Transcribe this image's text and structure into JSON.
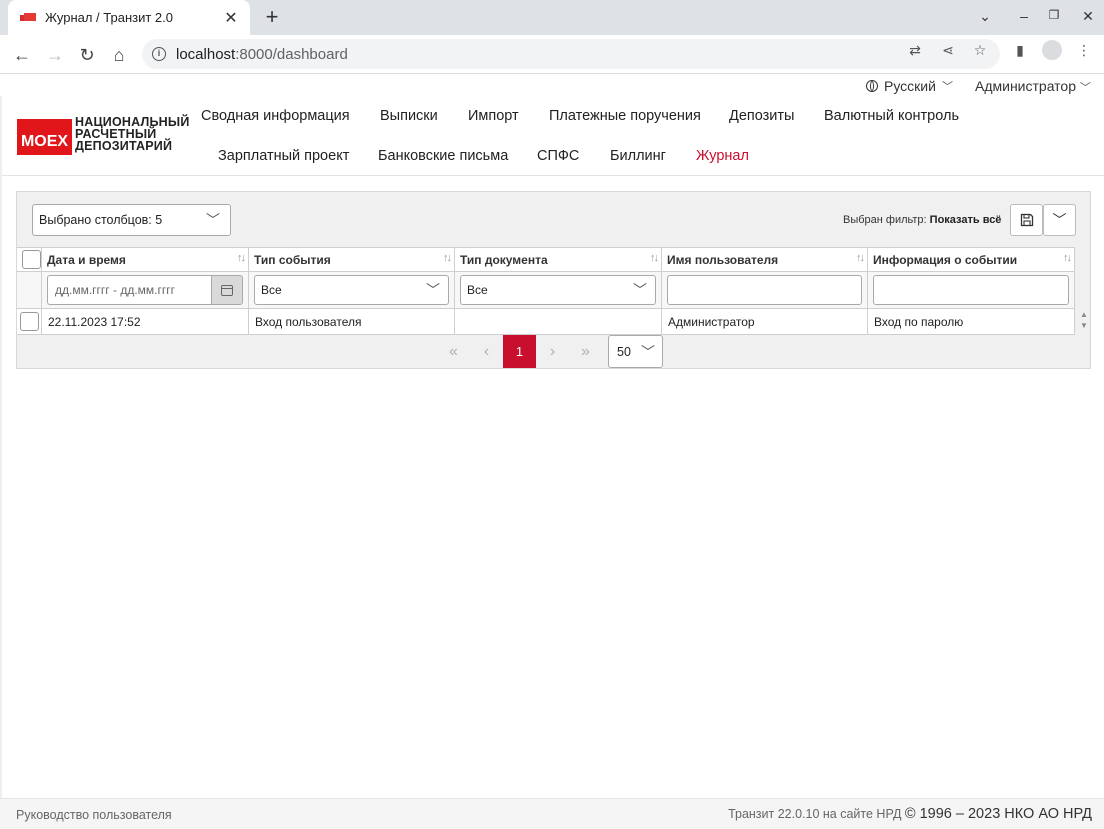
{
  "browser": {
    "tab_title": "Журнал / Транзит 2.0",
    "url_host": "localhost",
    "url_path": ":8000/dashboard"
  },
  "app": {
    "language": "Русский",
    "user": "Администратор",
    "logo_text": "MOEX",
    "logo_lines": [
      "НАЦИОНАЛЬНЫЙ",
      "РАСЧЕТНЫЙ",
      "ДЕПОЗИТАРИЙ"
    ],
    "brand_color": "#e1161b",
    "accent_color": "#c8102e",
    "nav_row1": [
      "Сводная информация",
      "Выписки",
      "Импорт",
      "Платежные поручения",
      "Депозиты",
      "Валютный контроль"
    ],
    "nav_row2": [
      "Зарплатный проект",
      "Банковские письма",
      "СПФС",
      "Биллинг",
      "Журнал"
    ],
    "active_nav": "Журнал"
  },
  "toolbar": {
    "columns_selected": "Выбрано столбцов: 5",
    "filter_label": "Выбран фильтр:",
    "filter_value": "Показать всё"
  },
  "table": {
    "columns": [
      "Дата и время",
      "Тип события",
      "Тип документа",
      "Имя пользователя",
      "Информация о событии"
    ],
    "filters": {
      "date_placeholder": "дд.мм.гггг - дд.мм.гггг",
      "event_type": "Все",
      "doc_type": "Все"
    },
    "rows": [
      [
        "22.11.2023 17:52",
        "Вход пользователя",
        "",
        "Администратор",
        "Вход по паролю"
      ]
    ]
  },
  "pager": {
    "current_page": "1",
    "page_size": "50"
  },
  "footer": {
    "manual_link": "Руководство пользователя",
    "version": "Транзит 22.0.10 на сайте НРД",
    "copyright": "© 1996 – 2023 НКО АО НРД"
  }
}
